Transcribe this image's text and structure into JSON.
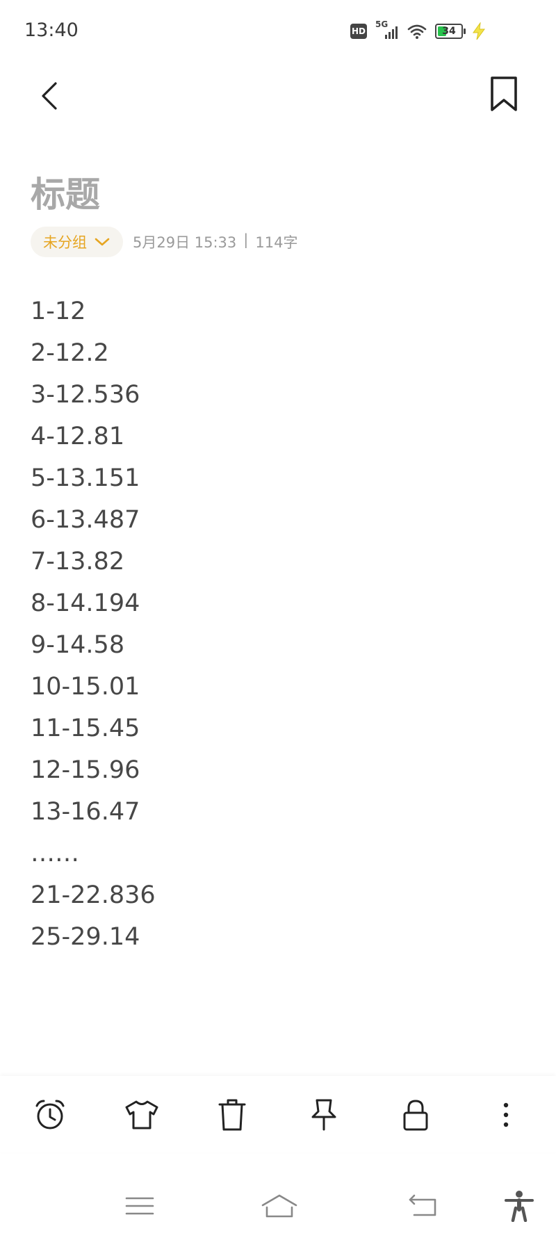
{
  "status": {
    "time": "13:40",
    "hd": "HD",
    "network": "5G",
    "battery": "34",
    "battery_level": 0.34,
    "battery_color": "#27c24c",
    "icons": [
      "hd-icon",
      "signal-5g-icon",
      "wifi-icon",
      "battery-icon",
      "charging-icon"
    ]
  },
  "header": {
    "back_icon": "chevron-left-icon",
    "bookmark_icon": "bookmark-icon"
  },
  "note": {
    "title_placeholder": "标题",
    "group_label": "未分组",
    "date": "5月29日 15:33",
    "separator": "|",
    "char_count": "114字",
    "lines": [
      "1-12",
      "2-12.2",
      "3-12.536",
      "4-12.81",
      "5-13.151",
      "6-13.487",
      "7-13.82",
      "8-14.194",
      "9-14.58",
      "10-15.01",
      "11-15.45",
      "12-15.96",
      "13-16.47",
      "……",
      "21-22.836",
      "25-29.14"
    ]
  },
  "toolbar": {
    "items": [
      "alarm-icon",
      "shirt-icon",
      "trash-icon",
      "pin-icon",
      "lock-icon",
      "more-icon"
    ]
  },
  "navbar": {
    "items": [
      "menu-icon",
      "home-icon",
      "back-icon",
      "accessibility-icon"
    ]
  },
  "colors": {
    "accent": "#e6a521",
    "text": "#474747",
    "muted": "#9a9a9a"
  }
}
